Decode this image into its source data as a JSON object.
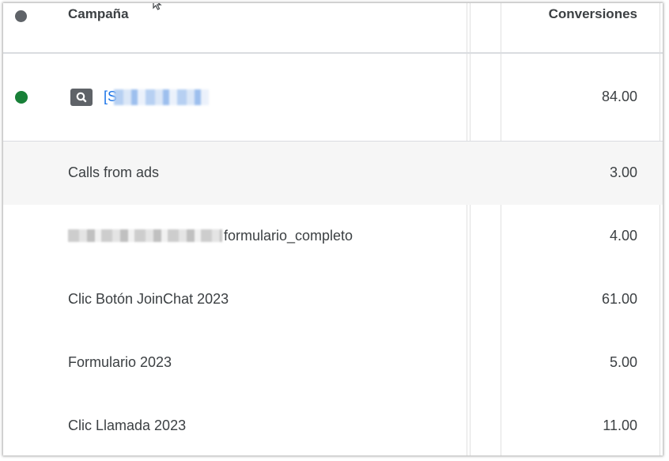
{
  "header": {
    "campaign_label": "Campaña",
    "conversions_label": "Conversiones",
    "status_color": "#5f6368"
  },
  "campaign": {
    "status_color": "#188038",
    "type_icon": "search-icon",
    "name_visible": "[S",
    "conversions": "84.00"
  },
  "conversion_actions": [
    {
      "label": "Calls from ads",
      "value": "3.00"
    },
    {
      "label": "formulario_completo",
      "value": "4.00"
    },
    {
      "label": "Clic Botón JoinChat 2023",
      "value": "61.00"
    },
    {
      "label": "Formulario 2023",
      "value": "5.00"
    },
    {
      "label": "Clic Llamada 2023",
      "value": "11.00"
    }
  ],
  "colors": {
    "link": "#1a73e8",
    "text": "#3c4043",
    "row_hover": "#f6f6f6"
  }
}
